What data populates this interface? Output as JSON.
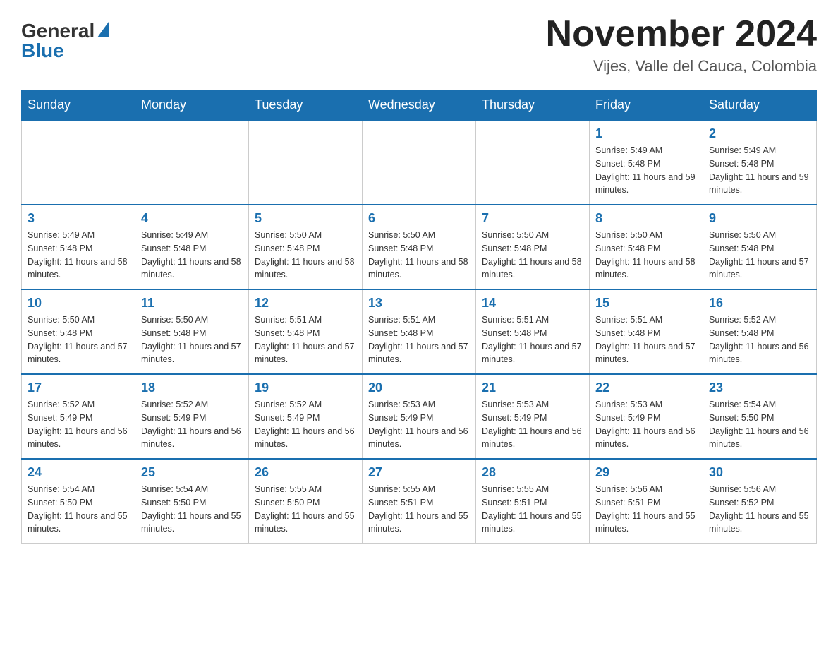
{
  "header": {
    "logo_general": "General",
    "logo_blue": "Blue",
    "title": "November 2024",
    "location": "Vijes, Valle del Cauca, Colombia"
  },
  "calendar": {
    "days_of_week": [
      "Sunday",
      "Monday",
      "Tuesday",
      "Wednesday",
      "Thursday",
      "Friday",
      "Saturday"
    ],
    "weeks": [
      [
        {
          "day": "",
          "info": ""
        },
        {
          "day": "",
          "info": ""
        },
        {
          "day": "",
          "info": ""
        },
        {
          "day": "",
          "info": ""
        },
        {
          "day": "",
          "info": ""
        },
        {
          "day": "1",
          "info": "Sunrise: 5:49 AM\nSunset: 5:48 PM\nDaylight: 11 hours and 59 minutes."
        },
        {
          "day": "2",
          "info": "Sunrise: 5:49 AM\nSunset: 5:48 PM\nDaylight: 11 hours and 59 minutes."
        }
      ],
      [
        {
          "day": "3",
          "info": "Sunrise: 5:49 AM\nSunset: 5:48 PM\nDaylight: 11 hours and 58 minutes."
        },
        {
          "day": "4",
          "info": "Sunrise: 5:49 AM\nSunset: 5:48 PM\nDaylight: 11 hours and 58 minutes."
        },
        {
          "day": "5",
          "info": "Sunrise: 5:50 AM\nSunset: 5:48 PM\nDaylight: 11 hours and 58 minutes."
        },
        {
          "day": "6",
          "info": "Sunrise: 5:50 AM\nSunset: 5:48 PM\nDaylight: 11 hours and 58 minutes."
        },
        {
          "day": "7",
          "info": "Sunrise: 5:50 AM\nSunset: 5:48 PM\nDaylight: 11 hours and 58 minutes."
        },
        {
          "day": "8",
          "info": "Sunrise: 5:50 AM\nSunset: 5:48 PM\nDaylight: 11 hours and 58 minutes."
        },
        {
          "day": "9",
          "info": "Sunrise: 5:50 AM\nSunset: 5:48 PM\nDaylight: 11 hours and 57 minutes."
        }
      ],
      [
        {
          "day": "10",
          "info": "Sunrise: 5:50 AM\nSunset: 5:48 PM\nDaylight: 11 hours and 57 minutes."
        },
        {
          "day": "11",
          "info": "Sunrise: 5:50 AM\nSunset: 5:48 PM\nDaylight: 11 hours and 57 minutes."
        },
        {
          "day": "12",
          "info": "Sunrise: 5:51 AM\nSunset: 5:48 PM\nDaylight: 11 hours and 57 minutes."
        },
        {
          "day": "13",
          "info": "Sunrise: 5:51 AM\nSunset: 5:48 PM\nDaylight: 11 hours and 57 minutes."
        },
        {
          "day": "14",
          "info": "Sunrise: 5:51 AM\nSunset: 5:48 PM\nDaylight: 11 hours and 57 minutes."
        },
        {
          "day": "15",
          "info": "Sunrise: 5:51 AM\nSunset: 5:48 PM\nDaylight: 11 hours and 57 minutes."
        },
        {
          "day": "16",
          "info": "Sunrise: 5:52 AM\nSunset: 5:48 PM\nDaylight: 11 hours and 56 minutes."
        }
      ],
      [
        {
          "day": "17",
          "info": "Sunrise: 5:52 AM\nSunset: 5:49 PM\nDaylight: 11 hours and 56 minutes."
        },
        {
          "day": "18",
          "info": "Sunrise: 5:52 AM\nSunset: 5:49 PM\nDaylight: 11 hours and 56 minutes."
        },
        {
          "day": "19",
          "info": "Sunrise: 5:52 AM\nSunset: 5:49 PM\nDaylight: 11 hours and 56 minutes."
        },
        {
          "day": "20",
          "info": "Sunrise: 5:53 AM\nSunset: 5:49 PM\nDaylight: 11 hours and 56 minutes."
        },
        {
          "day": "21",
          "info": "Sunrise: 5:53 AM\nSunset: 5:49 PM\nDaylight: 11 hours and 56 minutes."
        },
        {
          "day": "22",
          "info": "Sunrise: 5:53 AM\nSunset: 5:49 PM\nDaylight: 11 hours and 56 minutes."
        },
        {
          "day": "23",
          "info": "Sunrise: 5:54 AM\nSunset: 5:50 PM\nDaylight: 11 hours and 56 minutes."
        }
      ],
      [
        {
          "day": "24",
          "info": "Sunrise: 5:54 AM\nSunset: 5:50 PM\nDaylight: 11 hours and 55 minutes."
        },
        {
          "day": "25",
          "info": "Sunrise: 5:54 AM\nSunset: 5:50 PM\nDaylight: 11 hours and 55 minutes."
        },
        {
          "day": "26",
          "info": "Sunrise: 5:55 AM\nSunset: 5:50 PM\nDaylight: 11 hours and 55 minutes."
        },
        {
          "day": "27",
          "info": "Sunrise: 5:55 AM\nSunset: 5:51 PM\nDaylight: 11 hours and 55 minutes."
        },
        {
          "day": "28",
          "info": "Sunrise: 5:55 AM\nSunset: 5:51 PM\nDaylight: 11 hours and 55 minutes."
        },
        {
          "day": "29",
          "info": "Sunrise: 5:56 AM\nSunset: 5:51 PM\nDaylight: 11 hours and 55 minutes."
        },
        {
          "day": "30",
          "info": "Sunrise: 5:56 AM\nSunset: 5:52 PM\nDaylight: 11 hours and 55 minutes."
        }
      ]
    ]
  }
}
